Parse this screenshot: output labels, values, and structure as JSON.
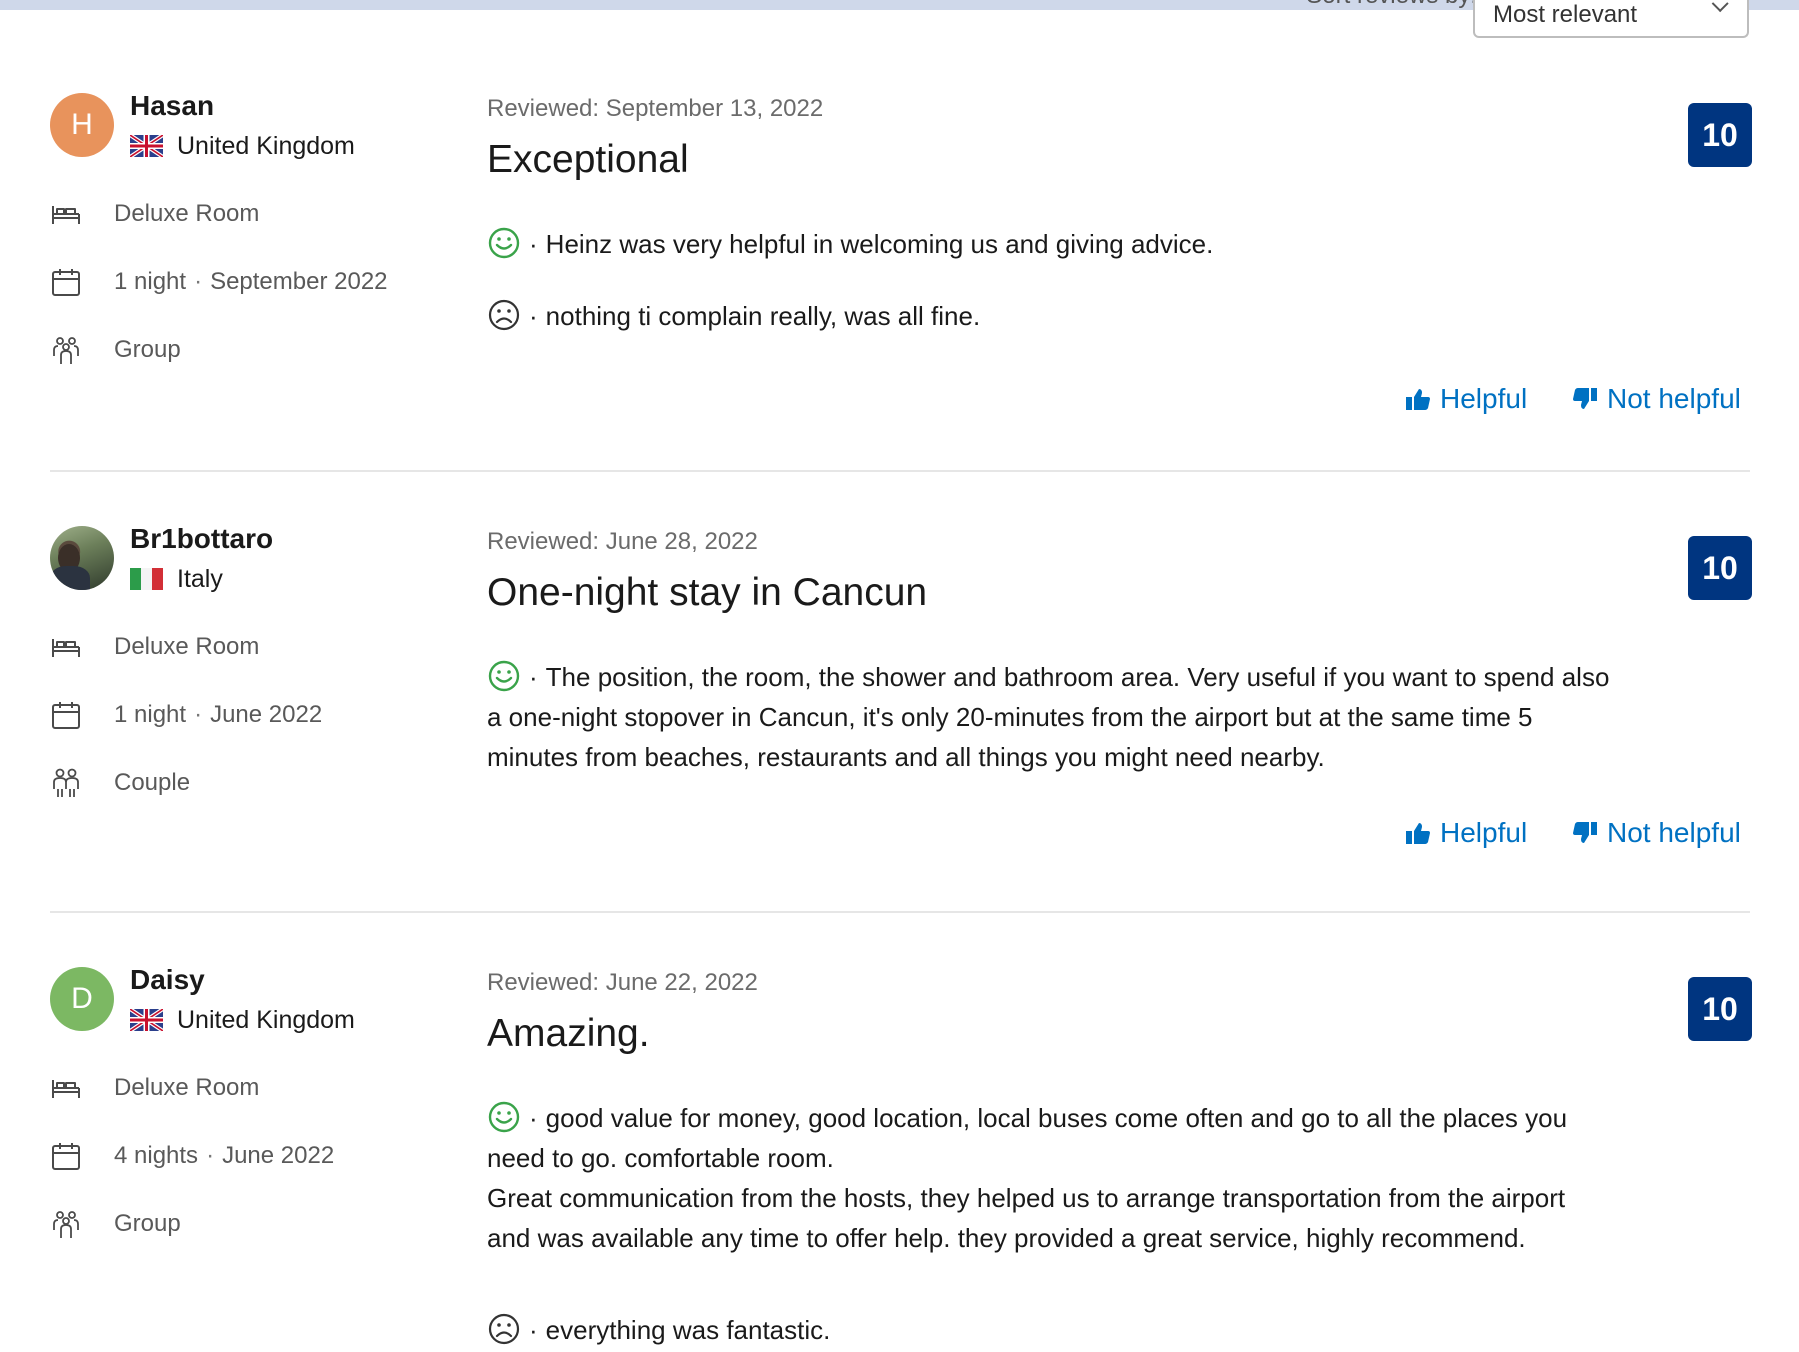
{
  "sort": {
    "label": "Sort reviews by:",
    "selected": "Most relevant"
  },
  "reviews": [
    {
      "avatar_letter": "H",
      "avatar_color": "#e8935c",
      "name": "Hasan",
      "country": "United Kingdom",
      "room": "Deluxe Room",
      "nights": "1 night",
      "stay_date": "September 2022",
      "traveler_type": "Group",
      "reviewed": "Reviewed: September 13, 2022",
      "title": "Exceptional",
      "score": "10",
      "positive": "Heinz was very helpful in welcoming us and giving advice.",
      "negative": "nothing ti complain really, was all fine.",
      "helpful_label": "Helpful",
      "not_helpful_label": "Not helpful"
    },
    {
      "avatar_letter": "",
      "name": "Br1bottaro",
      "country": "Italy",
      "room": "Deluxe Room",
      "nights": "1 night",
      "stay_date": "June 2022",
      "traveler_type": "Couple",
      "reviewed": "Reviewed: June 28, 2022",
      "title": "One-night stay in Cancun",
      "score": "10",
      "positive_lines": [
        "The position, the room, the shower and bathroom area. Very useful if you want to spend also",
        "a one-night stopover in Cancun, it's only 20-minutes from the airport but at the same time 5",
        "minutes from beaches, restaurants and all things you might need nearby."
      ],
      "helpful_label": "Helpful",
      "not_helpful_label": "Not helpful"
    },
    {
      "avatar_letter": "D",
      "avatar_color": "#7cb863",
      "name": "Daisy",
      "country": "United Kingdom",
      "room": "Deluxe Room",
      "nights": "4 nights",
      "stay_date": "June 2022",
      "traveler_type": "Group",
      "reviewed": "Reviewed: June 22, 2022",
      "title": "Amazing.",
      "score": "10",
      "positive_lines": [
        "good value for money, good location, local buses come often and go to all the places you",
        "need to go. comfortable room.",
        "Great communication from the hosts, they helped us to arrange transportation from the airport",
        "and was available any time to offer help. they provided a great service, highly recommend."
      ],
      "negative": "everything was fantastic."
    }
  ],
  "colors": {
    "score_bg": "#003580",
    "link": "#0071c2",
    "positive_face": "#3aa34a",
    "negative_face": "#333333"
  },
  "icons": {
    "room": "bed-icon",
    "stay": "calendar-icon",
    "group": "group-icon",
    "couple": "couple-icon",
    "positive": "smile-icon",
    "negative": "frown-icon",
    "helpful": "thumbs-up-icon",
    "not_helpful": "thumbs-down-icon"
  }
}
